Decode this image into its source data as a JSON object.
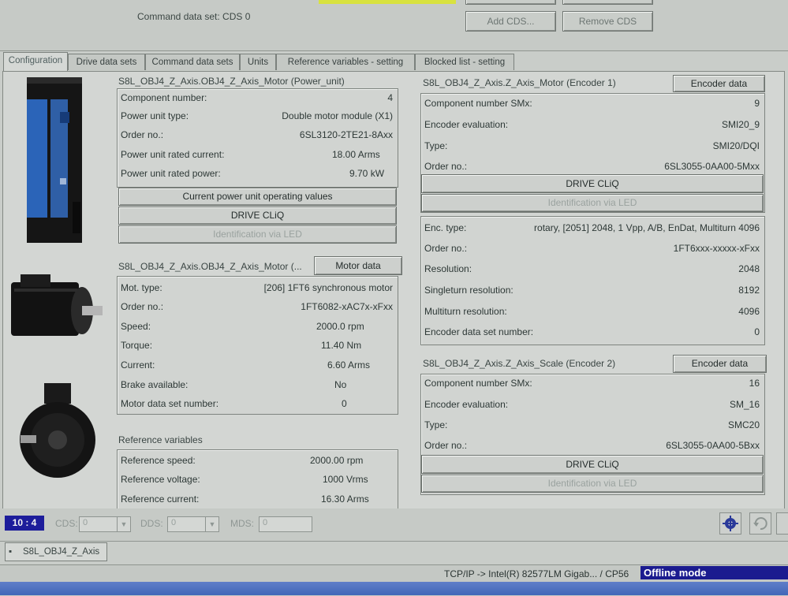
{
  "header": {
    "command_data_set": "Command data set: CDS 0",
    "add_cds": "Add CDS...",
    "remove_cds": "Remove CDS"
  },
  "tabs": [
    {
      "label": "Configuration",
      "active": true
    },
    {
      "label": "Drive data sets",
      "active": false
    },
    {
      "label": "Command data sets",
      "active": false
    },
    {
      "label": "Units",
      "active": false
    },
    {
      "label": "Reference variables - setting",
      "active": false
    },
    {
      "label": "Blocked list - setting",
      "active": false
    }
  ],
  "power_unit": {
    "title": "S8L_OBJ4_Z_Axis.OBJ4_Z_Axis_Motor (Power_unit)",
    "rows": [
      {
        "label": "Component number:",
        "value": "4"
      },
      {
        "label": "Power unit type:",
        "value": "Double motor module (X1)"
      },
      {
        "label": "Order no.:",
        "value": "6SL3120-2TE21-8Axx"
      },
      {
        "label": "Power unit rated current:",
        "value": "18.00 Arms"
      },
      {
        "label": "Power unit rated power:",
        "value": "9.70 kW"
      }
    ],
    "btn_operating_values": "Current power unit operating values",
    "btn_drive_cliq": "DRIVE CLiQ",
    "btn_identification": "Identification via LED"
  },
  "motor": {
    "title": "S8L_OBJ4_Z_Axis.OBJ4_Z_Axis_Motor (...",
    "btn_motor_data": "Motor data",
    "rows": [
      {
        "label": "Mot. type:",
        "value": "[206] 1FT6 synchronous motor"
      },
      {
        "label": "Order no.:",
        "value": "1FT6082-xAC7x-xFxx"
      },
      {
        "label": "Speed:",
        "value": "2000.0 rpm"
      },
      {
        "label": "Torque:",
        "value": "11.40 Nm"
      },
      {
        "label": "Current:",
        "value": "6.60 Arms"
      },
      {
        "label": "Brake available:",
        "value": "No"
      },
      {
        "label": "Motor data set number:",
        "value": "0"
      }
    ]
  },
  "reference": {
    "title": "Reference variables",
    "rows": [
      {
        "label": "Reference speed:",
        "value": "2000.00 rpm"
      },
      {
        "label": "Reference voltage:",
        "value": "1000 Vrms"
      },
      {
        "label": "Reference current:",
        "value": "16.30 Arms"
      }
    ]
  },
  "encoder1": {
    "title": "S8L_OBJ4_Z_Axis.Z_Axis_Motor (Encoder 1)",
    "btn_encoder_data": "Encoder data",
    "rows": [
      {
        "label": "Component number SMx:",
        "value": "9"
      },
      {
        "label": "Encoder evaluation:",
        "value": "SMI20_9"
      },
      {
        "label": "Type:",
        "value": "SMI20/DQI"
      },
      {
        "label": "Order no.:",
        "value": "6SL3055-0AA00-5Mxx"
      }
    ],
    "btn_drive_cliq": "DRIVE CLiQ",
    "btn_identification": "Identification via LED",
    "details": [
      {
        "label": "Enc. type:",
        "value": "rotary, [2051] 2048, 1 Vpp, A/B, EnDat, Multiturn 4096"
      },
      {
        "label": "Order no.:",
        "value": "1FT6xxx-xxxxx-xFxx"
      },
      {
        "label": "Resolution:",
        "value": "2048"
      },
      {
        "label": "Singleturn resolution:",
        "value": "8192"
      },
      {
        "label": "Multiturn resolution:",
        "value": "4096"
      },
      {
        "label": "Encoder data set number:",
        "value": "0"
      }
    ]
  },
  "encoder2": {
    "title": "S8L_OBJ4_Z_Axis.Z_Axis_Scale (Encoder 2)",
    "btn_encoder_data": "Encoder data",
    "rows": [
      {
        "label": "Component number SMx:",
        "value": "16"
      },
      {
        "label": "Encoder evaluation:",
        "value": "SM_16"
      },
      {
        "label": "Type:",
        "value": "SMC20"
      },
      {
        "label": "Order no.:",
        "value": "6SL3055-0AA00-5Bxx"
      }
    ],
    "btn_drive_cliq": "DRIVE CLiQ",
    "btn_identification": "Identification via LED"
  },
  "status": {
    "badge": "10 : 4",
    "cds_label": "CDS:",
    "cds_value": "0",
    "dds_label": "DDS:",
    "dds_value": "0",
    "mds_label": "MDS:",
    "mds_value": "0"
  },
  "bottom": {
    "doc_tab": "S8L_OBJ4_Z_Axis",
    "connection": "TCP/IP -> Intel(R) 82577LM Gigab... / CP56",
    "offline": "Offline mode"
  },
  "colors": {
    "badge_bg": "#1d1d9b",
    "offline_bg": "#1b1b8f",
    "panel_bg": "#d3d6d3"
  }
}
